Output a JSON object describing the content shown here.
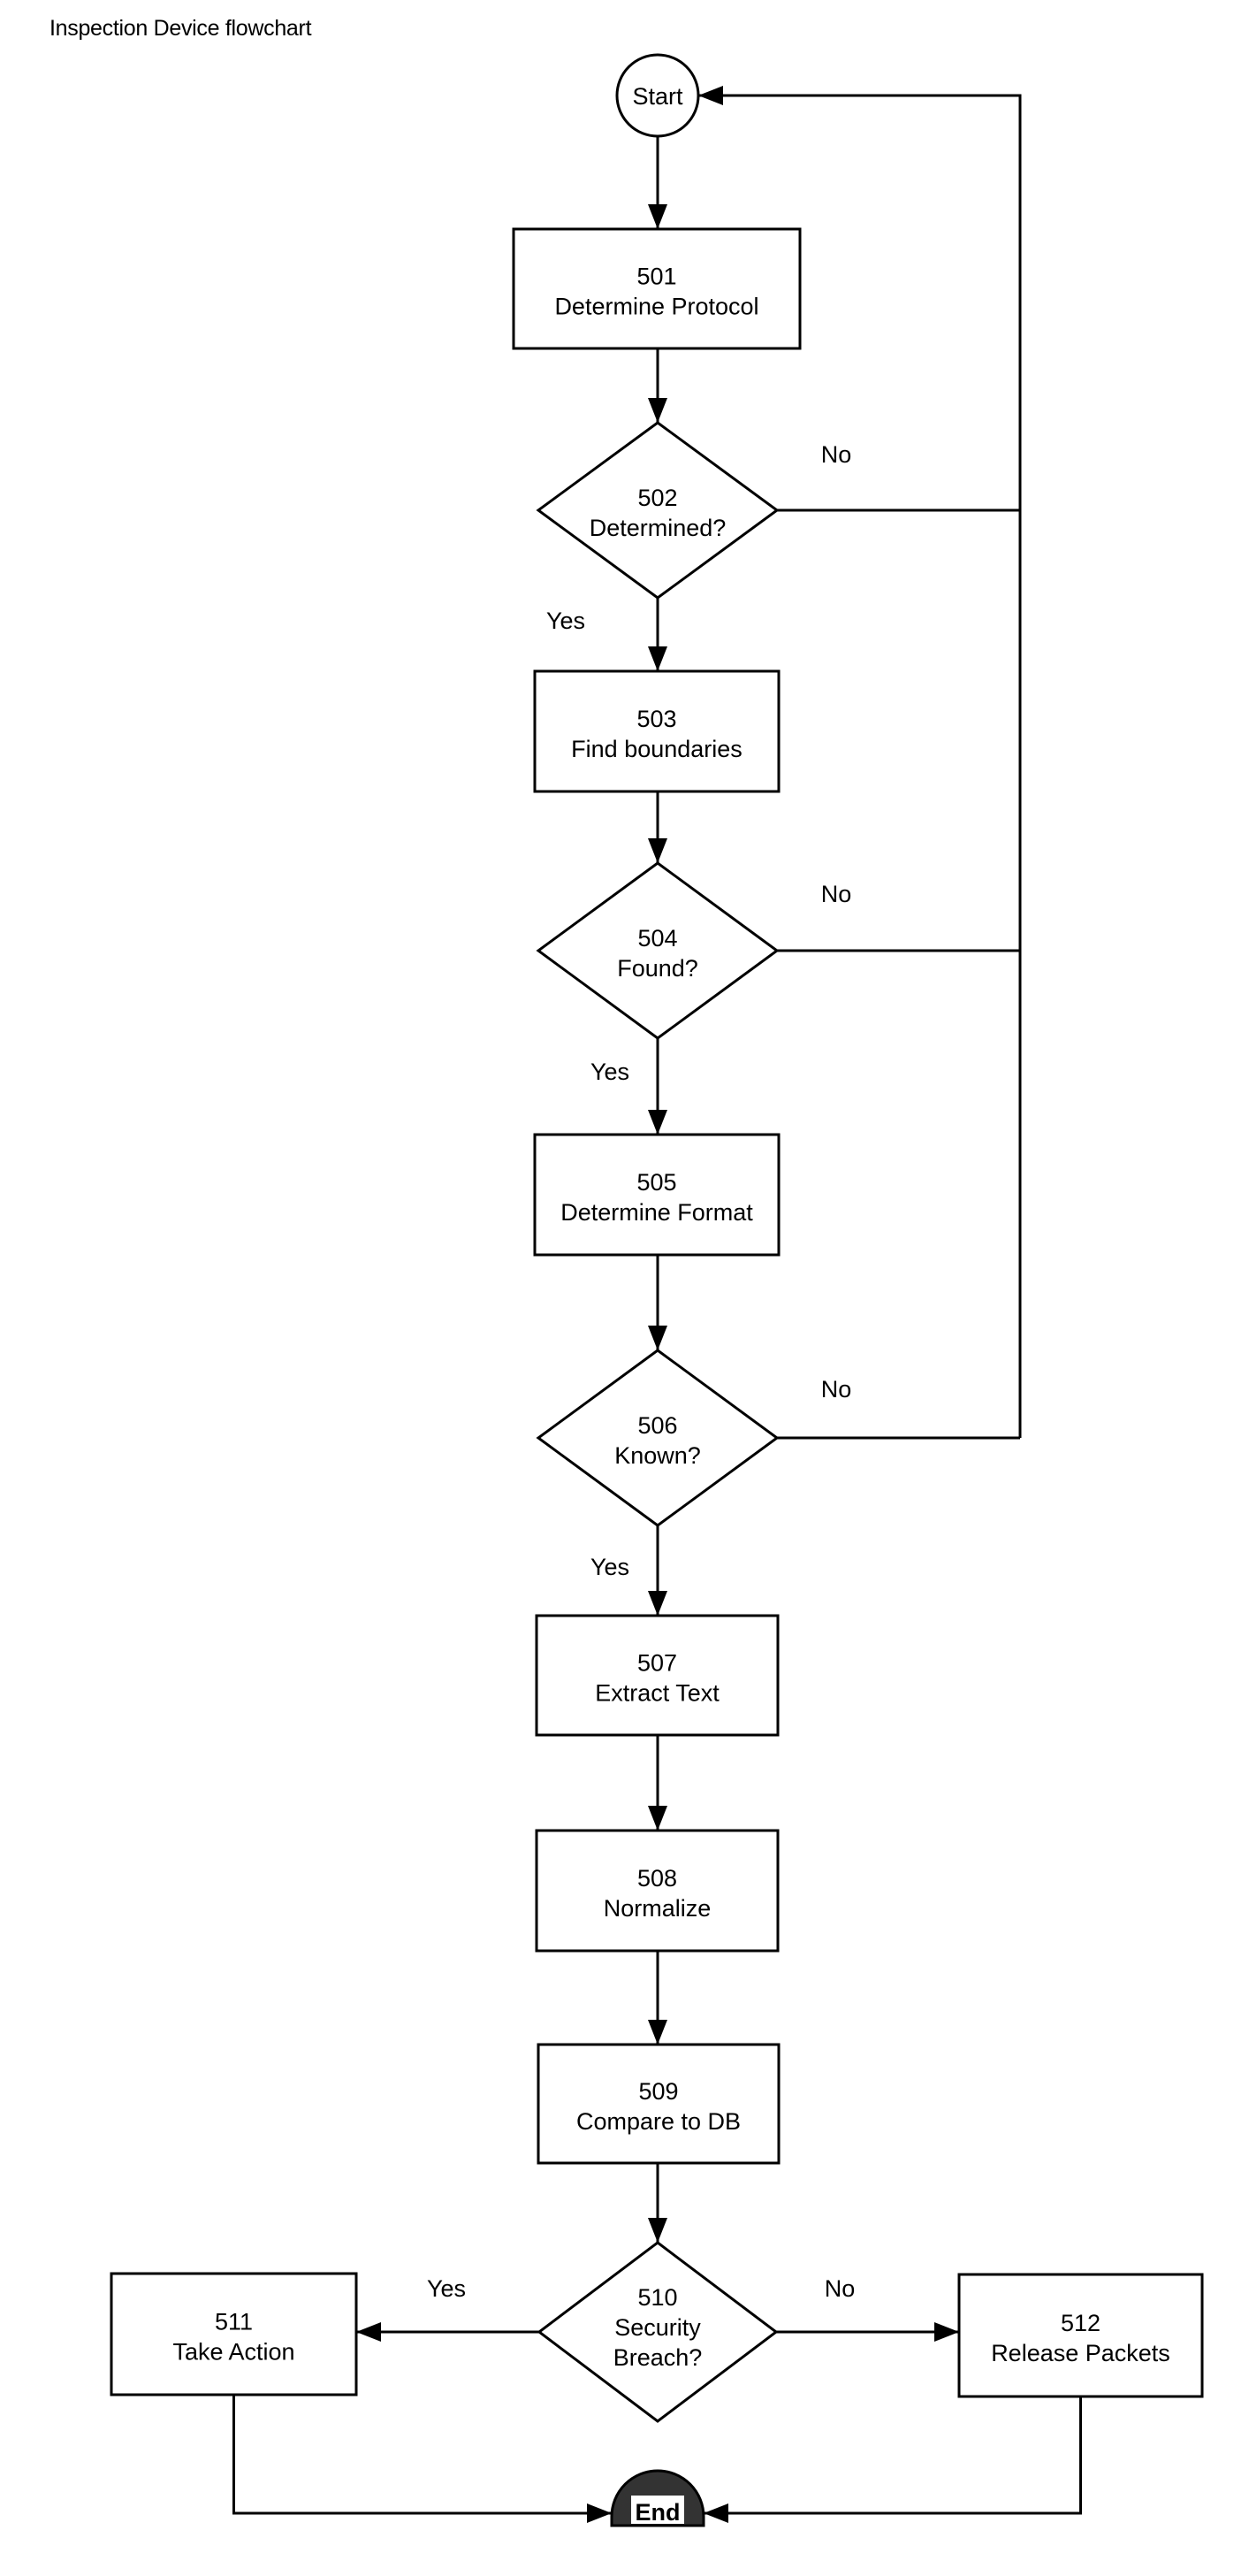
{
  "title": "Inspection Device flowchart",
  "nodes": {
    "start": {
      "type": "terminal",
      "label": "Start"
    },
    "501": {
      "type": "process",
      "id": "501",
      "label": "Determine Protocol"
    },
    "502": {
      "type": "decision",
      "id": "502",
      "label": "Determined?"
    },
    "503": {
      "type": "process",
      "id": "503",
      "label": "Find boundaries"
    },
    "504": {
      "type": "decision",
      "id": "504",
      "label": "Found?"
    },
    "505": {
      "type": "process",
      "id": "505",
      "label": "Determine Format"
    },
    "506": {
      "type": "decision",
      "id": "506",
      "label": "Known?"
    },
    "507": {
      "type": "process",
      "id": "507",
      "label": "Extract Text"
    },
    "508": {
      "type": "process",
      "id": "508",
      "label": "Normalize"
    },
    "509": {
      "type": "process",
      "id": "509",
      "label": "Compare to DB"
    },
    "510": {
      "type": "decision",
      "id": "510",
      "label_lines": [
        "Security",
        "Breach?"
      ]
    },
    "511": {
      "type": "process",
      "id": "511",
      "label": "Take Action"
    },
    "512": {
      "type": "process",
      "id": "512",
      "label": "Release Packets"
    },
    "end": {
      "type": "terminal",
      "label": "End"
    }
  },
  "edges": [
    {
      "from": "start",
      "to": "501"
    },
    {
      "from": "501",
      "to": "502"
    },
    {
      "from": "502",
      "to": "503",
      "label": "Yes"
    },
    {
      "from": "502",
      "to": "start",
      "label": "No"
    },
    {
      "from": "503",
      "to": "504"
    },
    {
      "from": "504",
      "to": "505",
      "label": "Yes"
    },
    {
      "from": "504",
      "to": "start",
      "label": "No"
    },
    {
      "from": "505",
      "to": "506"
    },
    {
      "from": "506",
      "to": "507",
      "label": "Yes"
    },
    {
      "from": "506",
      "to": "start",
      "label": "No"
    },
    {
      "from": "507",
      "to": "508"
    },
    {
      "from": "508",
      "to": "509"
    },
    {
      "from": "509",
      "to": "510"
    },
    {
      "from": "510",
      "to": "511",
      "label": "Yes"
    },
    {
      "from": "510",
      "to": "512",
      "label": "No"
    },
    {
      "from": "511",
      "to": "end"
    },
    {
      "from": "512",
      "to": "end"
    }
  ]
}
